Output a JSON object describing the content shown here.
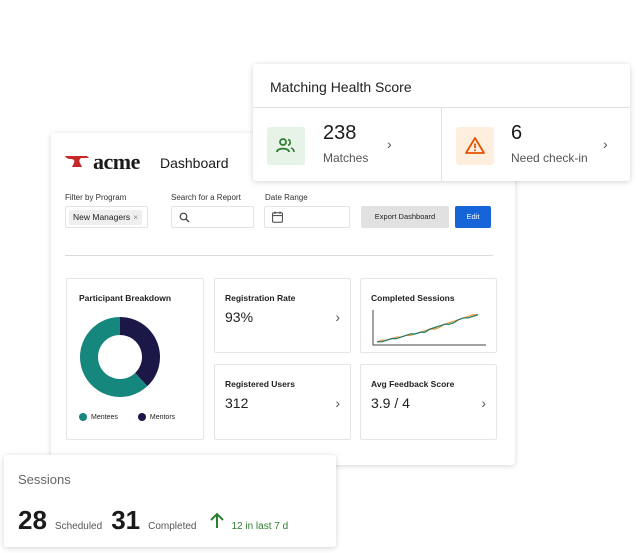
{
  "dashboard": {
    "brand": "acme",
    "title": "Dashboard",
    "filters": {
      "program_label": "Filter by Program",
      "program_chip": "New Managers",
      "search_label": "Search for a Report",
      "date_label": "Date Range"
    },
    "buttons": {
      "export": "Export Dashboard",
      "edit": "Edit"
    },
    "participant_breakdown": {
      "title": "Participant Breakdown",
      "legend": [
        {
          "label": "Mentees",
          "color": "#16877d"
        },
        {
          "label": "Mentors",
          "color": "#1b1747"
        }
      ]
    },
    "registration_rate": {
      "title": "Registration Rate",
      "value": "93%"
    },
    "completed_sessions": {
      "title": "Completed Sessions"
    },
    "registered_users": {
      "title": "Registered Users",
      "value": "312"
    },
    "avg_feedback": {
      "title": "Avg Feedback Score",
      "value": "3.9 / 4"
    }
  },
  "matching_health": {
    "title": "Matching Health Score",
    "matches": {
      "value": "238",
      "label": "Matches",
      "icon": "people-icon",
      "color": "#2e7d32",
      "bg": "#e6f3e6"
    },
    "checkin": {
      "value": "6",
      "label": "Need check-in",
      "icon": "warning-icon",
      "color": "#e65100",
      "bg": "#fdeede"
    }
  },
  "sessions": {
    "title": "Sessions",
    "scheduled_value": "28",
    "scheduled_label": "Scheduled",
    "completed_value": "31",
    "completed_label": "Completed",
    "trend": "12 in last 7 d",
    "trend_color": "#2e7d32"
  },
  "chart_data": [
    {
      "type": "pie",
      "title": "Participant Breakdown",
      "categories": [
        "Mentees",
        "Mentors"
      ],
      "values": [
        62,
        38
      ]
    },
    {
      "type": "line",
      "title": "Completed Sessions",
      "x": [
        1,
        2,
        3,
        4,
        5,
        6,
        7,
        8,
        9,
        10,
        11,
        12,
        13,
        14,
        15,
        16,
        17,
        18,
        19,
        20,
        21,
        22
      ],
      "series": [
        {
          "values": [
            2,
            3,
            3,
            4,
            5,
            5,
            6,
            6,
            7,
            8,
            9,
            10,
            10,
            11,
            13,
            14,
            15,
            16,
            17,
            18,
            19,
            19
          ]
        },
        {
          "values": [
            2,
            2,
            3,
            4,
            4,
            5,
            6,
            7,
            7,
            8,
            8,
            10,
            11,
            12,
            13,
            13,
            14,
            16,
            17,
            17,
            18,
            19
          ]
        }
      ],
      "colors": [
        "#e69a3c",
        "#1f7a6b"
      ],
      "ylim": [
        0,
        22
      ]
    }
  ]
}
